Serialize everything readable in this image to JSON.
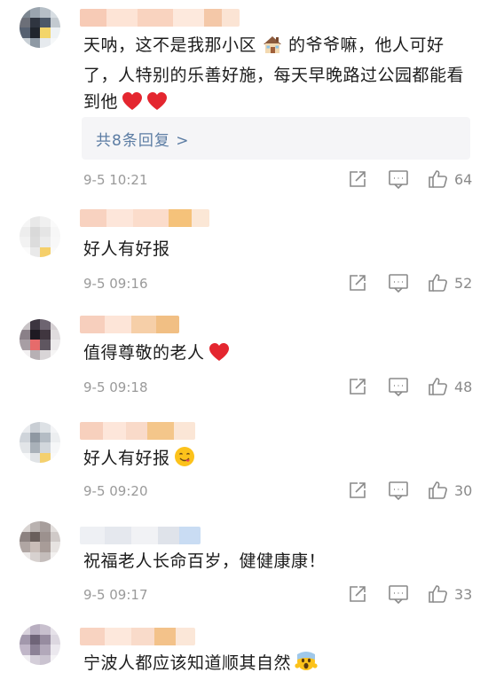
{
  "comments": [
    {
      "text": "天呐，这不是我那小区",
      "text_after": "的爷爷嘛，他人可好了，人特别的乐善好施，每天早晚路过公园都能看到他",
      "replies_label": "共8条回复 >",
      "time": "9-5 10:21",
      "likes": "64",
      "colors": {
        "username": [
          "#f6c9b4",
          "#fbe2d3",
          "#f9d6c2",
          "#fde7da"
        ],
        "accent": "#f2b25e"
      }
    },
    {
      "text": "好人有好报",
      "time": "9-5 09:16",
      "likes": "52"
    },
    {
      "text": "值得尊敬的老人",
      "time": "9-5 09:18",
      "likes": "48"
    },
    {
      "text": "好人有好报",
      "time": "9-5 09:20",
      "likes": "30"
    },
    {
      "text": "祝福老人长命百岁，健健康康！",
      "time": "9-5 09:17",
      "likes": "33"
    },
    {
      "text": "宁波人都应该知道顺其自然"
    }
  ],
  "icons": {
    "share": "share-icon",
    "comment": "comment-icon",
    "like": "thumbs-up-icon",
    "heart": "red-heart-emoji",
    "house": "house-emoji",
    "yum": "face-savoring-food-emoji",
    "scream": "face-screaming-emoji"
  },
  "colors": {
    "link": "#5b7ca3",
    "meta": "#9a9a9a",
    "heart": "#e4262f",
    "reply_bg": "#f5f5f7"
  }
}
